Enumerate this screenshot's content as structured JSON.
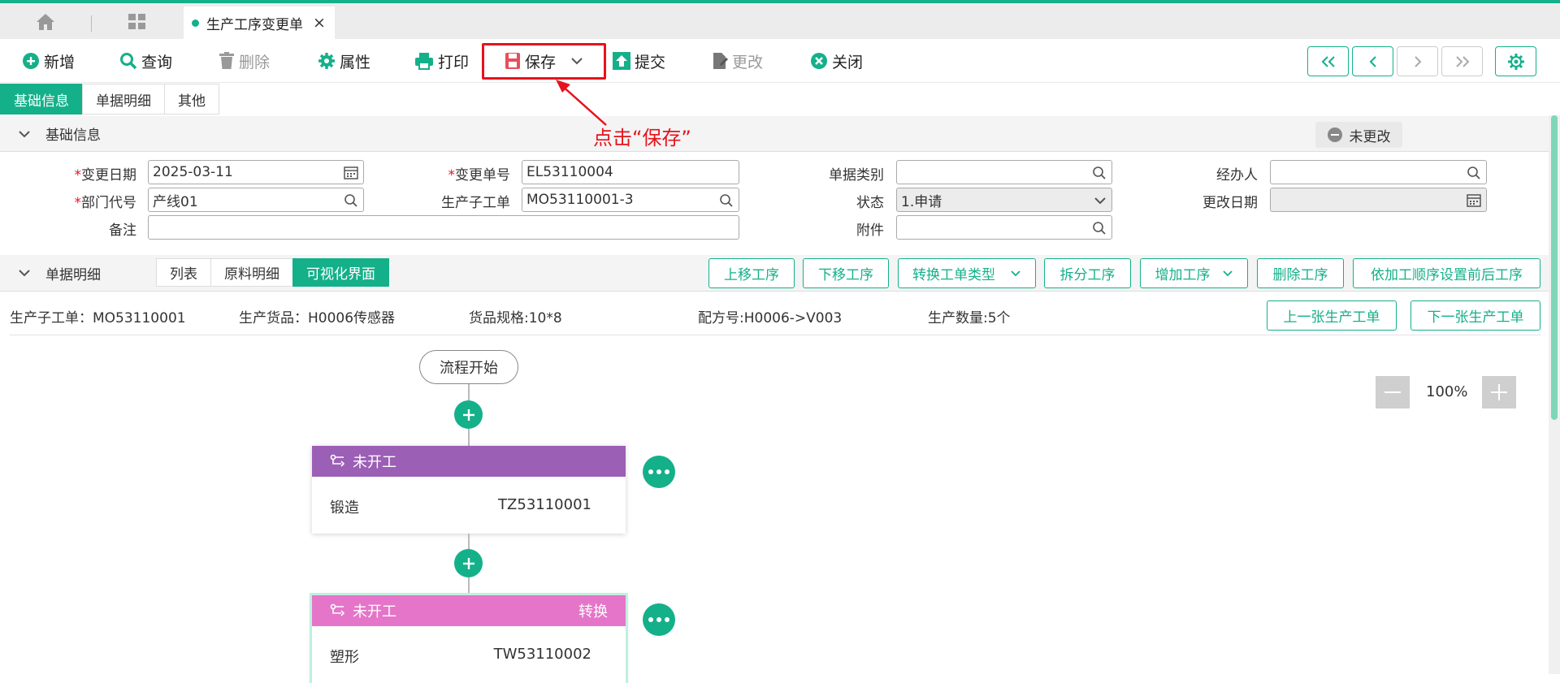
{
  "tabbar": {
    "doc_tab_label": "生产工序变更单",
    "close_symbol": "×"
  },
  "toolbar": {
    "new": "新增",
    "query": "查询",
    "delete": "删除",
    "properties": "属性",
    "print": "打印",
    "save": "保存",
    "submit": "提交",
    "modify": "更改",
    "close": "关闭"
  },
  "annotation": "点击“保存”",
  "subtabs": [
    "基础信息",
    "单据明细",
    "其他"
  ],
  "basic_section": {
    "title": "基础信息",
    "status_badge": "未更改"
  },
  "form": {
    "change_date_label": "变更日期",
    "change_date_value": "2025-03-11",
    "change_no_label": "变更单号",
    "change_no_value": "EL53110004",
    "doc_type_label": "单据类别",
    "doc_type_value": "",
    "handler_label": "经办人",
    "handler_value": "",
    "dept_label": "部门代号",
    "dept_value": "产线01",
    "sub_order_label": "生产子工单",
    "sub_order_value": "MO53110001-3",
    "status_label": "状态",
    "status_value": "1.申请",
    "modify_date_label": "更改日期",
    "modify_date_value": "",
    "remark_label": "备注",
    "remark_value": "",
    "attachment_label": "附件",
    "attachment_value": "",
    "required_mark": "*"
  },
  "detail_section": {
    "title": "单据明细",
    "view_tabs": [
      "列表",
      "原料明细",
      "可视化界面"
    ],
    "actions": {
      "move_up": "上移工序",
      "move_down": "下移工序",
      "convert_type": "转换工单类型",
      "split": "拆分工序",
      "add": "增加工序",
      "delete": "删除工序",
      "set_order": "依加工顺序设置前后工序"
    }
  },
  "info": {
    "sub_order": "生产子工单：MO53110001",
    "goods": "生产货品：H0006传感器",
    "spec": "货品规格:10*8",
    "formula": "配方号:H0006->V003",
    "qty": "生产数量:5个",
    "prev_order": "上一张生产工单",
    "next_order": "下一张生产工单"
  },
  "flow": {
    "start": "流程开始",
    "zoom": "100%",
    "nodes": [
      {
        "status": "未开工",
        "name": "锻造",
        "code": "TZ53110001",
        "tag": "",
        "color": "#9b5fb5"
      },
      {
        "status": "未开工",
        "name": "塑形",
        "code": "TW53110002",
        "tag": "转换",
        "color": "#e575c8"
      }
    ]
  },
  "colors": {
    "accent": "#14b08a",
    "annotation_red": "#e8121c"
  }
}
